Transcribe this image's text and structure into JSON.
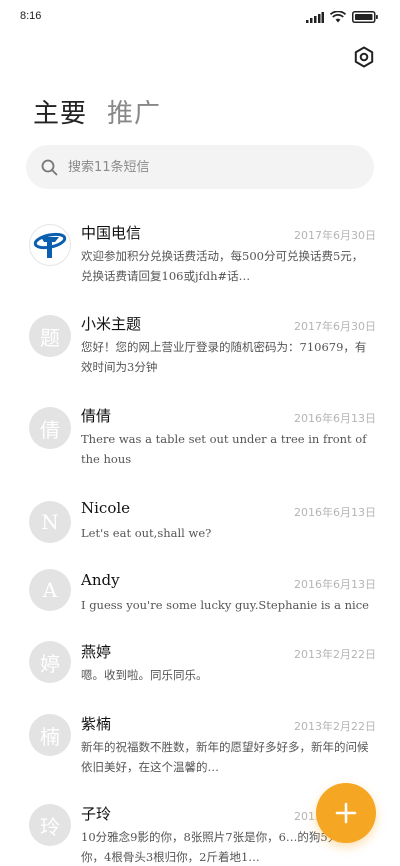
{
  "status_bar": {
    "time": "8:16"
  },
  "tabs": [
    {
      "label": "主要"
    },
    {
      "label": "推广"
    }
  ],
  "search": {
    "placeholder": "搜索11条短信"
  },
  "messages": [
    {
      "avatar_char": "",
      "avatar_icon": "china-telecom-logo",
      "sender": "中国电信",
      "date": "2017年6月30日",
      "preview": "欢迎参加积分兑换话费活动，每500分可兑换话费5元，兑换话费请回复106或jfdh#话…"
    },
    {
      "avatar_char": "题",
      "sender": "小米主题",
      "date": "2017年6月30日",
      "preview": "您好！您的网上营业厅登录的随机密码为：710679，有效时间为3分钟"
    },
    {
      "avatar_char": "倩",
      "sender": "倩倩",
      "date": "2016年6月13日",
      "preview": "There was a table set out under a tree in front of the hous"
    },
    {
      "avatar_char": "N",
      "sender": "Nicole",
      "date": "2016年6月13日",
      "preview": "Let's eat out,shall we?"
    },
    {
      "avatar_char": "A",
      "sender": "Andy",
      "date": "2016年6月13日",
      "preview": "I guess you're some lucky guy.Stephanie is a nice girl."
    },
    {
      "avatar_char": "婷",
      "sender": "燕婷",
      "date": "2013年2月22日",
      "preview": "嗯。收到啦。同乐同乐。"
    },
    {
      "avatar_char": "楠",
      "sender": "紫楠",
      "date": "2013年2月22日",
      "preview": "新年的祝福数不胜数，新年的愿望好多好多，新年的问候依旧美好，在这个温馨的…"
    },
    {
      "avatar_char": "玲",
      "sender": "子玲",
      "date": "2013年2月22日",
      "preview": "10分雅念9影的你，8张照片7张是你，6…的狗5只像你，4根骨头3根归你，2斤着地1…"
    }
  ],
  "colors": {
    "accent": "#f5a623",
    "telecom_blue": "#0b5fae"
  }
}
